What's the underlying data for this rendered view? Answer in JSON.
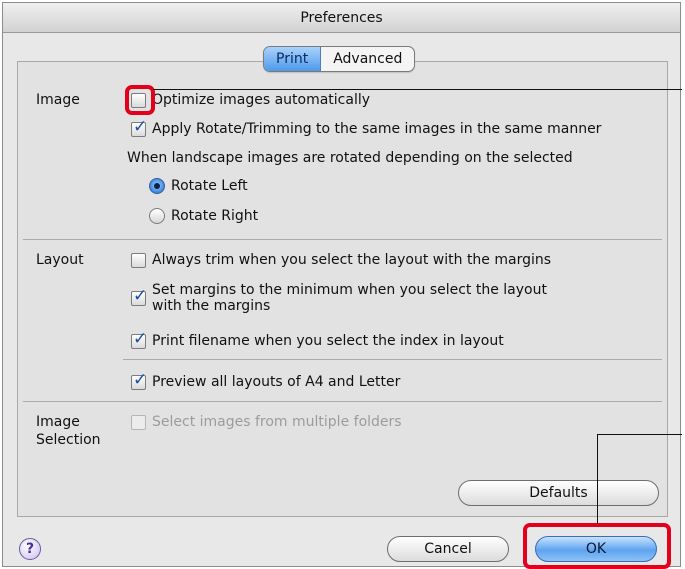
{
  "window": {
    "title": "Preferences"
  },
  "tabs": [
    {
      "label": "Print",
      "active": true
    },
    {
      "label": "Advanced",
      "active": false
    }
  ],
  "image_section": {
    "label": "Image",
    "optimize": {
      "label": "Optimize images automatically",
      "checked": false
    },
    "apply_rotate": {
      "label": "Apply Rotate/Trimming to the same images in the same manner",
      "checked": true
    },
    "landscape_text": "When landscape images are rotated depending on the selected",
    "rotate_left": {
      "label": "Rotate Left",
      "selected": true
    },
    "rotate_right": {
      "label": "Rotate Right",
      "selected": false
    }
  },
  "layout_section": {
    "label": "Layout",
    "always_trim": {
      "label": "Always trim when you select the layout with the margins",
      "checked": false
    },
    "set_margins": {
      "line1": "Set margins to the minimum when you select the layout",
      "line2": "with the margins",
      "checked": true
    },
    "print_filename": {
      "label": "Print filename when you select the index in layout",
      "checked": true
    },
    "preview_layouts": {
      "label": "Preview all layouts of A4 and Letter",
      "checked": true
    }
  },
  "image_selection_section": {
    "label_line1": "Image",
    "label_line2": "Selection",
    "select_multiple": {
      "label": "Select images from multiple folders",
      "checked": false,
      "enabled": false
    }
  },
  "buttons": {
    "defaults": "Defaults",
    "cancel": "Cancel",
    "ok": "OK",
    "help": "?"
  },
  "colors": {
    "highlight": "#e3001b",
    "accent": "#4f99ea"
  }
}
